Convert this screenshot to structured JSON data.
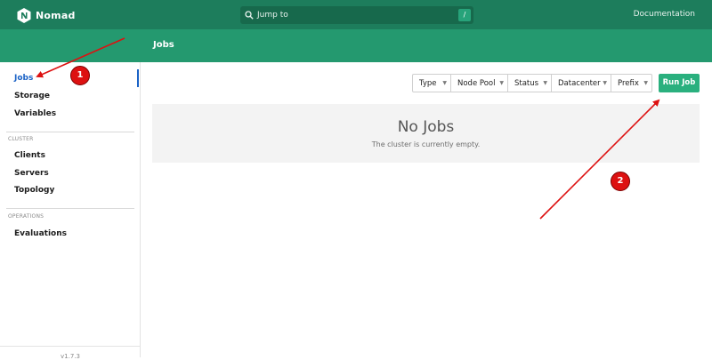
{
  "app": {
    "name": "Nomad",
    "logo_icon": "nomad-logo-icon"
  },
  "search": {
    "label": "Jump to",
    "shortcut": "/",
    "icon": "search-icon"
  },
  "header_links": {
    "documentation": "Documentation"
  },
  "page": {
    "title": "Jobs"
  },
  "sidebar": {
    "items": [
      {
        "label": "Jobs",
        "active": true
      },
      {
        "label": "Storage",
        "active": false
      },
      {
        "label": "Variables",
        "active": false
      }
    ],
    "cluster_section": "CLUSTER",
    "cluster_items": [
      {
        "label": "Clients"
      },
      {
        "label": "Servers"
      },
      {
        "label": "Topology"
      }
    ],
    "operations_section": "OPERATIONS",
    "operations_items": [
      {
        "label": "Evaluations"
      }
    ],
    "version": "v1.7.3"
  },
  "filters": [
    {
      "label": "Type"
    },
    {
      "label": "Node Pool"
    },
    {
      "label": "Status"
    },
    {
      "label": "Datacenter"
    },
    {
      "label": "Prefix"
    }
  ],
  "actions": {
    "run_job": "Run Job"
  },
  "empty_state": {
    "title": "No Jobs",
    "message": "The cluster is currently empty."
  },
  "annotations": {
    "badge_1": "1",
    "badge_2": "2",
    "color": "#dd1111"
  },
  "colors": {
    "topbar": "#1d7d5c",
    "header": "#24996f",
    "accent": "#2ab07e",
    "active_link": "#1b63c6"
  }
}
